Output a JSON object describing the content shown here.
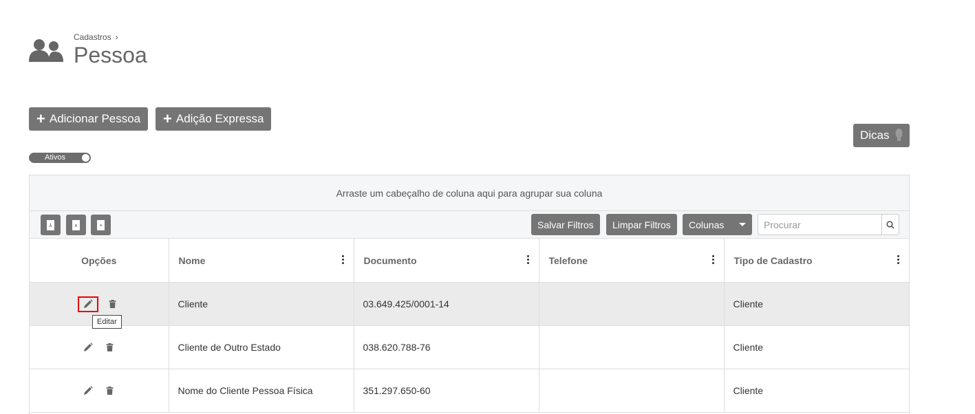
{
  "header": {
    "icon": "users-icon",
    "breadcrumb": "Cadastros",
    "breadcrumb_separator": "›",
    "title": "Pessoa"
  },
  "actions": {
    "add_person": "Adicionar Pessoa",
    "express_add": "Adição Expressa",
    "tips": "Dicas"
  },
  "filter_toggle": {
    "label": "Ativos",
    "on": true
  },
  "grid": {
    "group_hint": "Arraste um cabeçalho de coluna aqui para agrupar sua coluna",
    "export_buttons": [
      "pdf-export-icon",
      "excel-export-icon",
      "csv-export-icon"
    ],
    "toolbar": {
      "save_filters": "Salvar Filtros",
      "clear_filters": "Limpar Filtros",
      "columns": "Colunas",
      "search_placeholder": "Procurar"
    },
    "columns": [
      "Opções",
      "Nome",
      "Documento",
      "Telefone",
      "Tipo de Cadastro"
    ],
    "rows": [
      {
        "nome": "Cliente",
        "documento": "03.649.425/0001-14",
        "telefone": "",
        "tipo": "Cliente"
      },
      {
        "nome": "Cliente de Outro Estado",
        "documento": "038.620.788-76",
        "telefone": "",
        "tipo": "Cliente"
      },
      {
        "nome": "Nome do Cliente Pessoa Física",
        "documento": "351.297.650-60",
        "telefone": "",
        "tipo": "Cliente"
      }
    ],
    "edit_tooltip": "Editar"
  },
  "colors": {
    "button_gray": "#757575",
    "highlight": "#e00000",
    "selected_row": "#ebebeb"
  }
}
